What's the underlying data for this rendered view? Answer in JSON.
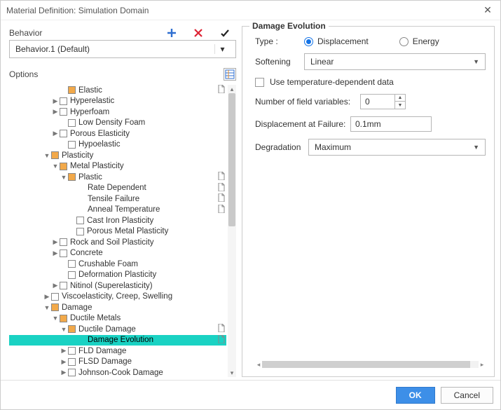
{
  "window": {
    "title": "Material Definition: Simulation Domain"
  },
  "behavior": {
    "label": "Behavior",
    "value": "Behavior.1 (Default)"
  },
  "options": {
    "label": "Options"
  },
  "tree": [
    {
      "indent": 72,
      "expand": "",
      "check": "orange",
      "label": "Elastic",
      "doc": true
    },
    {
      "indent": 60,
      "expand": "▶",
      "check": "white",
      "label": "Hyperelastic"
    },
    {
      "indent": 60,
      "expand": "▶",
      "check": "white",
      "label": "Hyperfoam"
    },
    {
      "indent": 72,
      "expand": "",
      "check": "white",
      "label": "Low Density Foam"
    },
    {
      "indent": 60,
      "expand": "▶",
      "check": "white",
      "label": "Porous Elasticity"
    },
    {
      "indent": 72,
      "expand": "",
      "check": "white",
      "label": "Hypoelastic"
    },
    {
      "indent": 48,
      "expand": "▼",
      "check": "orange",
      "label": "Plasticity"
    },
    {
      "indent": 60,
      "expand": "▼",
      "check": "orange",
      "label": "Metal Plasticity"
    },
    {
      "indent": 72,
      "expand": "▼",
      "check": "orange",
      "label": "Plastic",
      "doc": true
    },
    {
      "indent": 100,
      "expand": "",
      "check": "",
      "label": "Rate Dependent",
      "doc": true
    },
    {
      "indent": 100,
      "expand": "",
      "check": "",
      "label": "Tensile Failure",
      "doc": true
    },
    {
      "indent": 100,
      "expand": "",
      "check": "",
      "label": "Anneal Temperature",
      "doc": true
    },
    {
      "indent": 84,
      "expand": "",
      "check": "white",
      "label": "Cast Iron Plasticity"
    },
    {
      "indent": 84,
      "expand": "",
      "check": "white",
      "label": "Porous Metal Plasticity"
    },
    {
      "indent": 60,
      "expand": "▶",
      "check": "white",
      "label": "Rock and Soil Plasticity"
    },
    {
      "indent": 60,
      "expand": "▶",
      "check": "white",
      "label": "Concrete"
    },
    {
      "indent": 72,
      "expand": "",
      "check": "white",
      "label": "Crushable Foam"
    },
    {
      "indent": 72,
      "expand": "",
      "check": "white",
      "label": "Deformation Plasticity"
    },
    {
      "indent": 60,
      "expand": "▶",
      "check": "white",
      "label": "Nitinol (Superelasticity)"
    },
    {
      "indent": 48,
      "expand": "▶",
      "check": "white",
      "label": "Viscoelasticity, Creep, Swelling"
    },
    {
      "indent": 48,
      "expand": "▼",
      "check": "orange",
      "label": "Damage"
    },
    {
      "indent": 60,
      "expand": "▼",
      "check": "orange",
      "label": "Ductile Metals"
    },
    {
      "indent": 72,
      "expand": "▼",
      "check": "orange",
      "label": "Ductile Damage",
      "doc": true
    },
    {
      "indent": 100,
      "expand": "",
      "check": "",
      "label": "Damage Evolution",
      "doc": true,
      "selected": true
    },
    {
      "indent": 72,
      "expand": "▶",
      "check": "white",
      "label": "FLD Damage"
    },
    {
      "indent": 72,
      "expand": "▶",
      "check": "white",
      "label": "FLSD Damage"
    },
    {
      "indent": 72,
      "expand": "▶",
      "check": "white",
      "label": "Johnson-Cook Damage"
    }
  ],
  "panel": {
    "title": "Damage Evolution",
    "type_label": "Type :",
    "type_options": {
      "displacement": "Displacement",
      "energy": "Energy"
    },
    "type_selected": "displacement",
    "softening_label": "Softening",
    "softening_value": "Linear",
    "temp_dep_label": "Use temperature-dependent data",
    "nfv_label": "Number of field variables:",
    "nfv_value": "0",
    "disp_fail_label": "Displacement at Failure:",
    "disp_fail_value": "0.1mm",
    "degradation_label": "Degradation",
    "degradation_value": "Maximum"
  },
  "footer": {
    "ok": "OK",
    "cancel": "Cancel"
  }
}
